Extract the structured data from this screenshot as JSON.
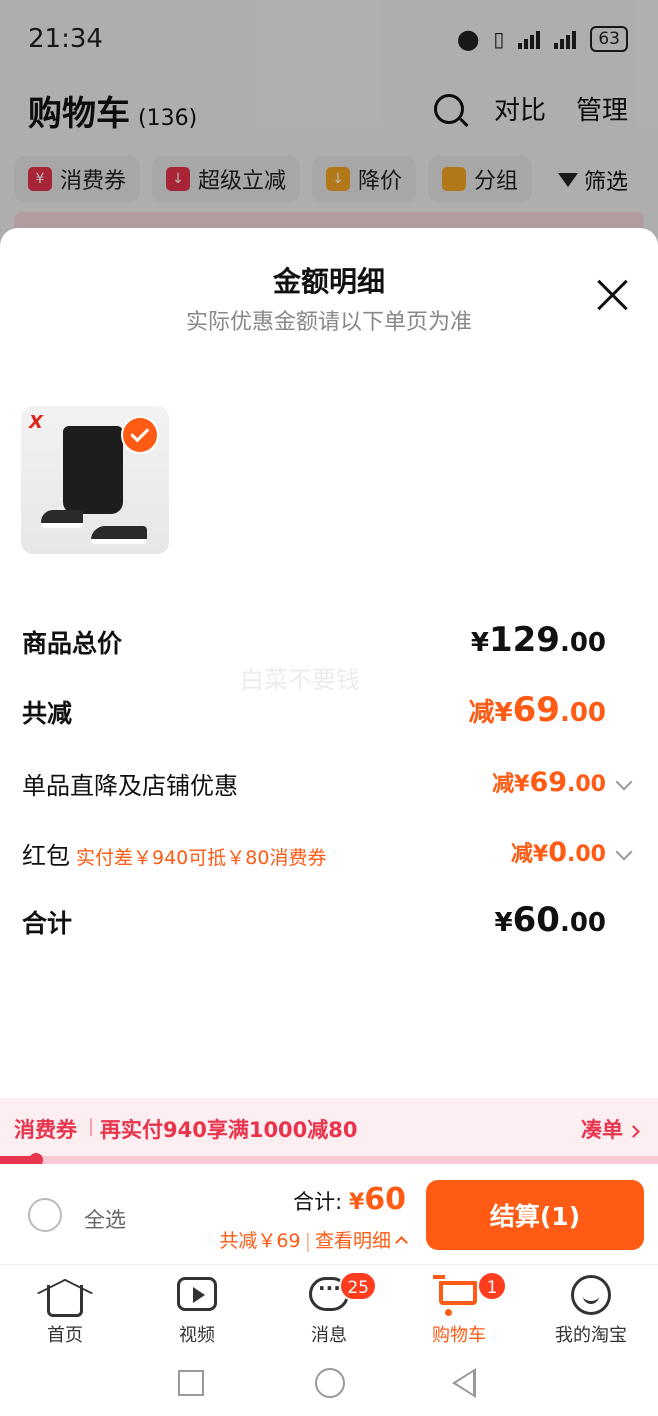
{
  "status_bar": {
    "time": "21:34",
    "battery": "63"
  },
  "cart_header": {
    "title": "购物车",
    "count": "(136)",
    "compare": "对比",
    "manage": "管理"
  },
  "filter_chips": [
    {
      "label": "消费券",
      "icon": "coupon-icon",
      "color": "#e8344c"
    },
    {
      "label": "超级立减",
      "icon": "arrow-down-icon",
      "color": "#e8344c"
    },
    {
      "label": "降价",
      "icon": "price-drop-icon",
      "color": "#f5a623"
    },
    {
      "label": "分组",
      "icon": "folder-icon",
      "color": "#f5a623"
    }
  ],
  "filter_label": "筛选",
  "sheet": {
    "title": "金额明细",
    "subtitle": "实际优惠金额请以下单页为准",
    "watermark": "白菜不要钱",
    "product_brand": "X",
    "rows": {
      "subtotal": {
        "label": "商品总价",
        "currency": "¥",
        "int": "129",
        "dec": ".00"
      },
      "discount_total": {
        "label": "共减",
        "prefix": "减",
        "currency": "¥",
        "int": "69",
        "dec": ".00"
      },
      "item_discount": {
        "label": "单品直降及店铺优惠",
        "prefix": "减",
        "currency": "¥",
        "int": "69",
        "dec": ".00"
      },
      "red_packet": {
        "label": "红包",
        "hint": "实付差￥940可抵￥80消费券",
        "prefix": "减",
        "currency": "¥",
        "int": "0",
        "dec": ".00"
      },
      "total": {
        "label": "合计",
        "currency": "¥",
        "int": "60",
        "dec": ".00"
      }
    }
  },
  "promo": {
    "tag": "消费券",
    "text": "再实付940享满1000减80",
    "link": "凑单",
    "progress": 0.05
  },
  "checkout": {
    "select_all": "全选",
    "total_label": "合计:",
    "currency": "¥",
    "total_amount": "60",
    "discount_text": "共减￥69",
    "detail_link": "查看明细",
    "pay_button": "结算(1)"
  },
  "tabs": [
    {
      "label": "首页",
      "icon": "home-icon",
      "active": false
    },
    {
      "label": "视频",
      "icon": "video-icon",
      "active": false
    },
    {
      "label": "消息",
      "icon": "message-icon",
      "badge": "25",
      "active": false
    },
    {
      "label": "购物车",
      "icon": "cart-icon",
      "badge": "1",
      "active": true
    },
    {
      "label": "我的淘宝",
      "icon": "profile-icon",
      "active": false
    }
  ],
  "colors": {
    "accent": "#ff5b14",
    "promo": "#e8344c"
  }
}
